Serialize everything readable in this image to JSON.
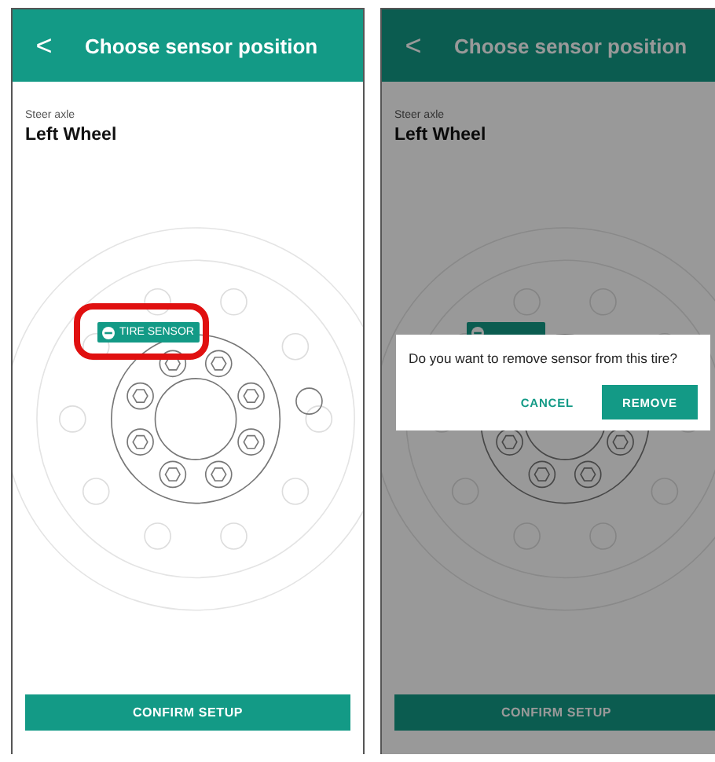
{
  "screens": [
    {
      "header": {
        "back": "<",
        "title": "Choose sensor position"
      },
      "axle": "Steer axle",
      "wheel": "Left Wheel",
      "sensor": {
        "placed": true,
        "label": "TIRE SENSOR"
      },
      "highlighted": true,
      "confirm_button": "CONFIRM SETUP"
    },
    {
      "header": {
        "back": "<",
        "title": "Choose sensor position"
      },
      "axle": "Steer axle",
      "wheel": "Left Wheel",
      "sensor": {
        "placed": true
      },
      "highlighted": false,
      "confirm_button": "CONFIRM SETUP",
      "dialog": {
        "message": "Do you want to remove sensor from this tire?",
        "cancel": "CANCEL",
        "confirm": "REMOVE"
      }
    }
  ]
}
